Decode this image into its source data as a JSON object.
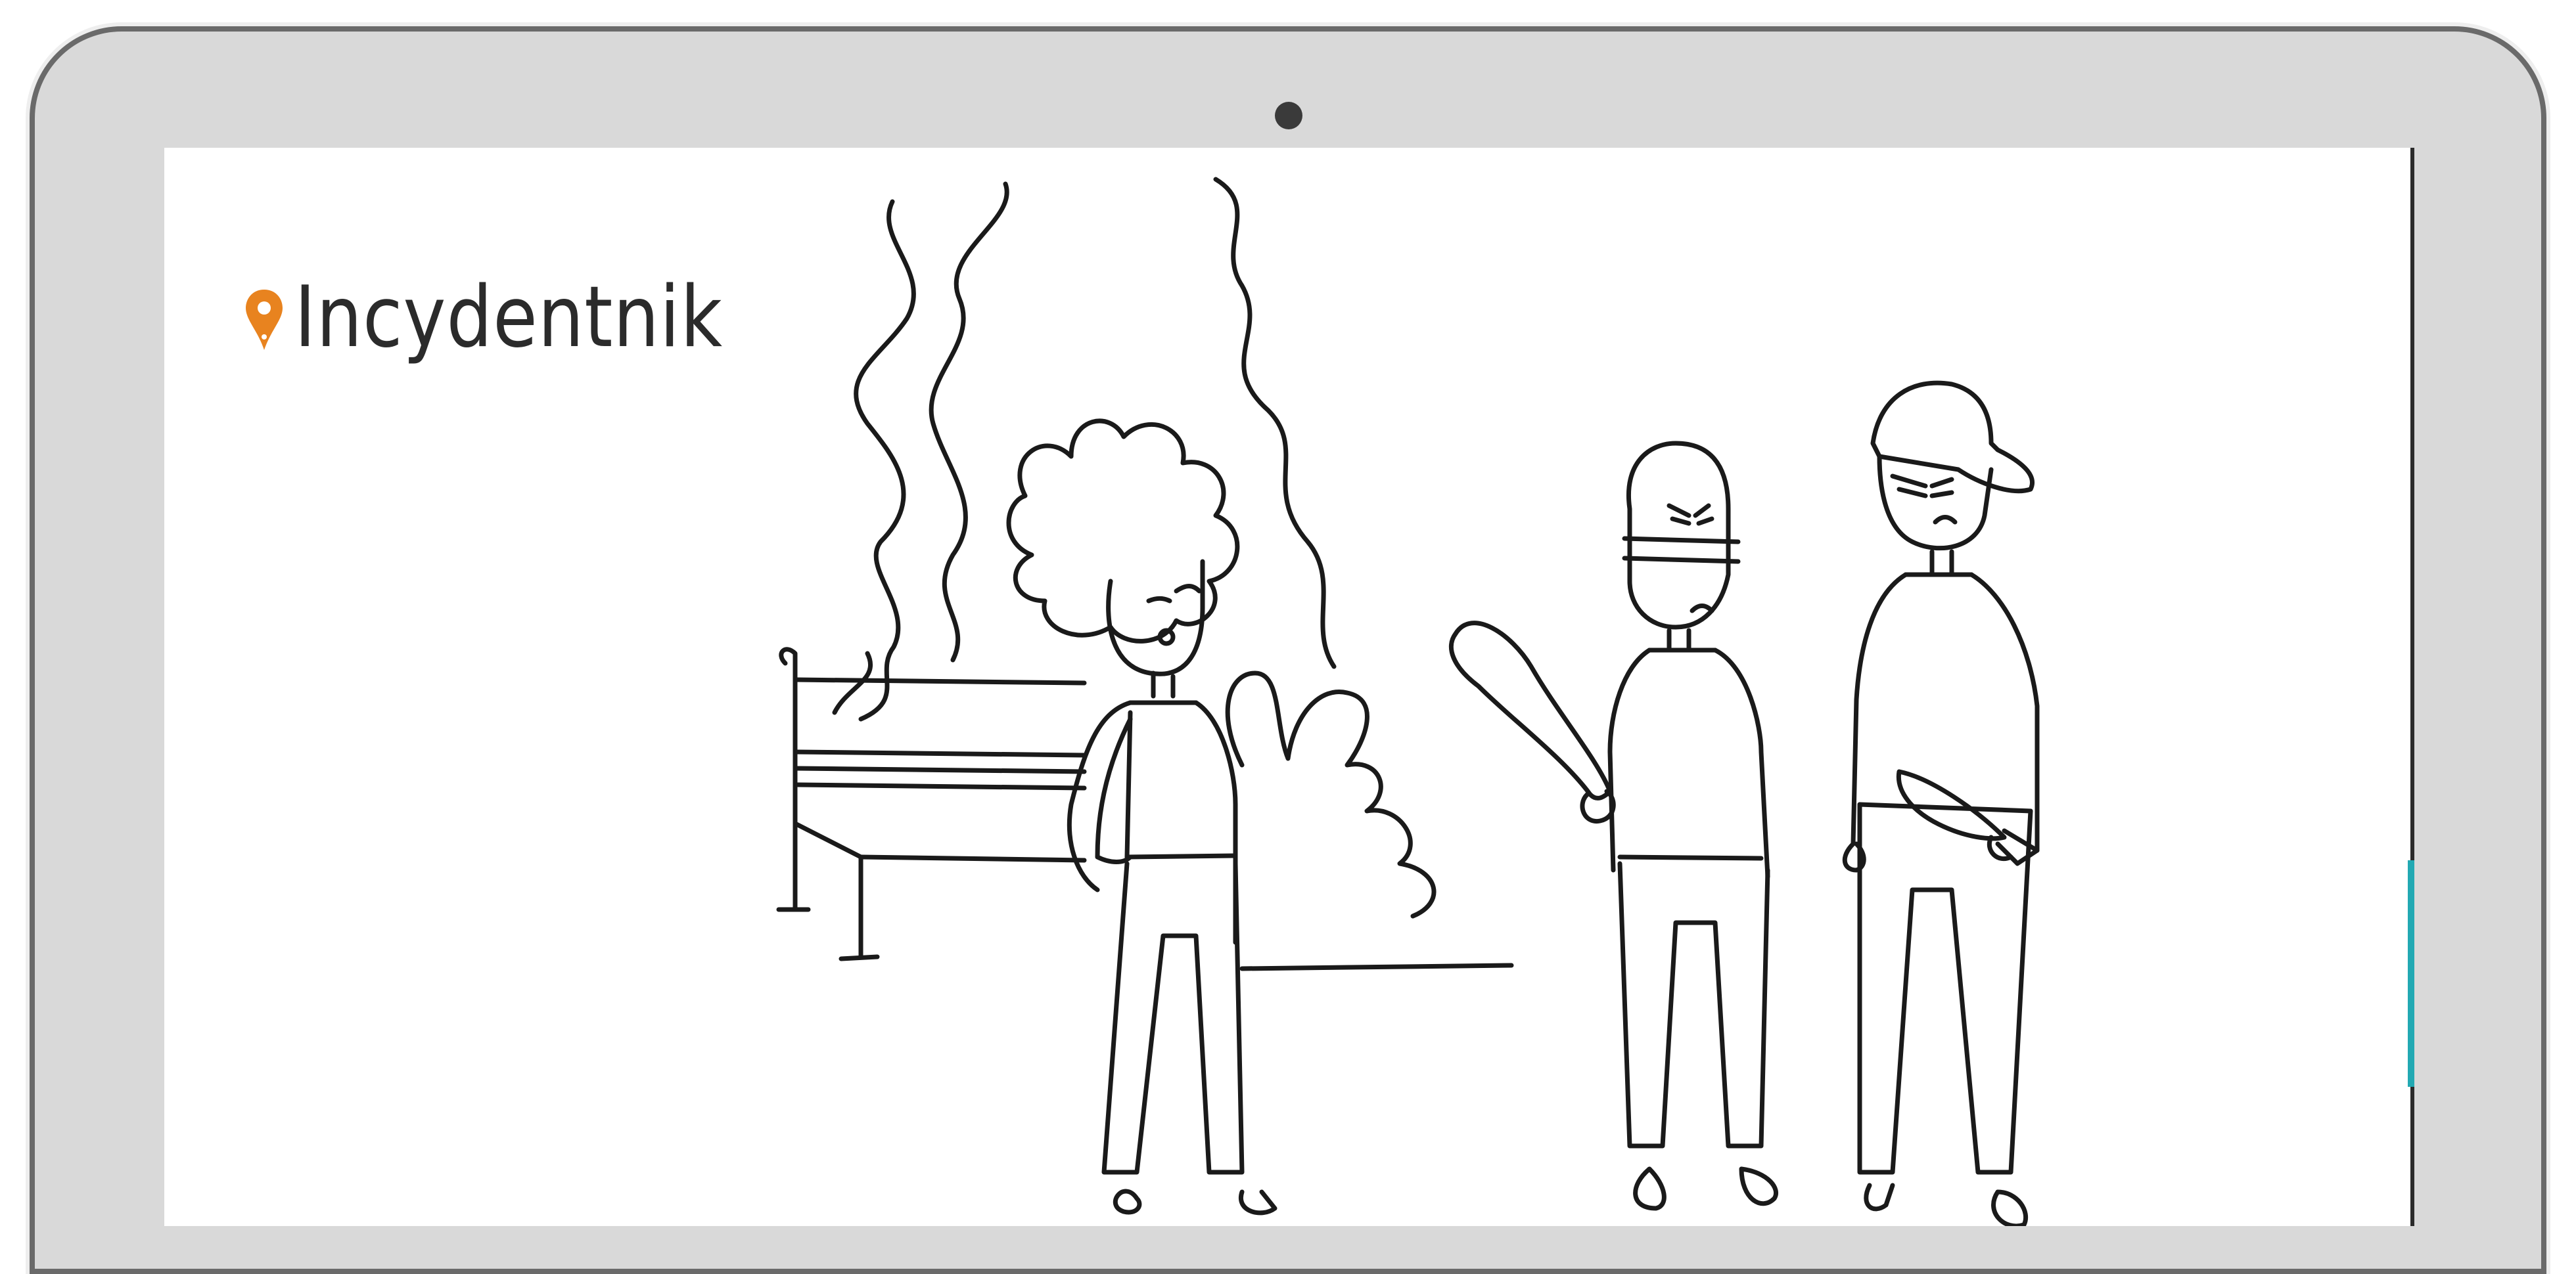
{
  "brand": {
    "name": "Incydentnik",
    "logo_icon": "map-pin-icon",
    "accent_color": "#e8831f"
  },
  "illustration": {
    "figures": [
      "woman-with-curly-hair",
      "bald-man-with-bat",
      "man-with-cap-and-knife"
    ],
    "scene_objects": [
      "park-bench",
      "smoke",
      "bush"
    ]
  }
}
